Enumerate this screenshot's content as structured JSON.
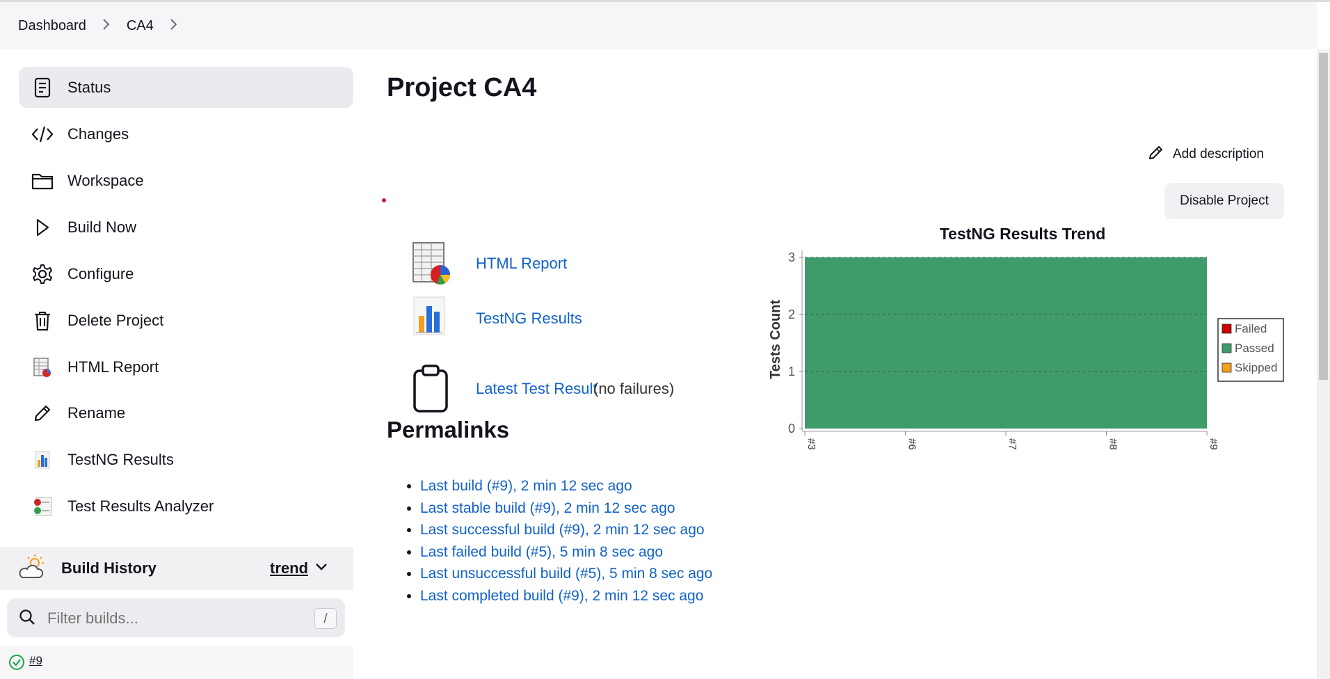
{
  "breadcrumb": {
    "items": [
      "Dashboard",
      "CA4"
    ]
  },
  "sidebar": {
    "items": [
      {
        "label": "Status",
        "icon": "status-icon",
        "active": true
      },
      {
        "label": "Changes",
        "icon": "code-icon"
      },
      {
        "label": "Workspace",
        "icon": "folder-icon"
      },
      {
        "label": "Build Now",
        "icon": "play-icon"
      },
      {
        "label": "Configure",
        "icon": "gear-icon"
      },
      {
        "label": "Delete Project",
        "icon": "trash-icon"
      },
      {
        "label": "HTML Report",
        "icon": "html-report-icon"
      },
      {
        "label": "Rename",
        "icon": "pencil-icon"
      },
      {
        "label": "TestNG Results",
        "icon": "bar-chart-icon"
      },
      {
        "label": "Test Results Analyzer",
        "icon": "analyzer-icon"
      }
    ]
  },
  "build_history": {
    "title": "Build History",
    "trend_label": "trend",
    "filter_placeholder": "Filter builds...",
    "shortcut": "/",
    "builds": [
      {
        "label": "#9",
        "status": "success"
      }
    ]
  },
  "main": {
    "title": "Project CA4",
    "add_description": "Add description",
    "disable_button": "Disable Project",
    "actions": [
      {
        "label": "HTML Report"
      },
      {
        "label": "TestNG Results"
      },
      {
        "label": "Latest Test Result",
        "suffix": "(no failures)"
      }
    ],
    "permalinks_title": "Permalinks",
    "permalinks": [
      "Last build (#9), 2 min 12 sec ago",
      "Last stable build (#9), 2 min 12 sec ago",
      "Last successful build (#9), 2 min 12 sec ago",
      "Last failed build (#5), 5 min 8 sec ago",
      "Last unsuccessful build (#5), 5 min 8 sec ago",
      "Last completed build (#9), 2 min 12 sec ago"
    ]
  },
  "colors": {
    "link": "#1162c9",
    "passed": "#3f9b6a",
    "failed": "#cc0000",
    "skipped": "#f0a01c"
  },
  "chart_data": {
    "type": "area",
    "title": "TestNG Results Trend",
    "ylabel": "Tests Count",
    "x": [
      "#3",
      "#6",
      "#7",
      "#8",
      "#9"
    ],
    "series": [
      {
        "name": "Failed",
        "values": [
          0,
          0,
          0,
          0,
          0
        ]
      },
      {
        "name": "Passed",
        "values": [
          3,
          3,
          3,
          3,
          3
        ]
      },
      {
        "name": "Skipped",
        "values": [
          0,
          0,
          0,
          0,
          0
        ]
      }
    ],
    "ylim": [
      0,
      3
    ],
    "yticks": [
      "0",
      "1",
      "2",
      "3"
    ],
    "grid": true,
    "legend": "right"
  }
}
